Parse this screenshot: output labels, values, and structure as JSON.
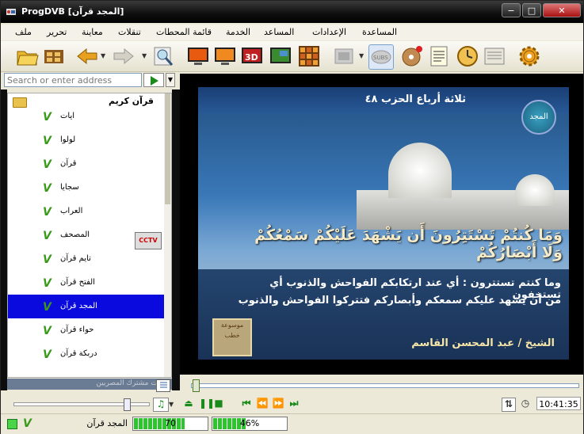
{
  "window": {
    "title": "ProgDVB [المجد قرآن]"
  },
  "window_buttons": {
    "minimize": "−",
    "restore": "□",
    "close": "✕"
  },
  "menu": [
    {
      "label": "المساعدة"
    },
    {
      "label": "الإعدادات"
    },
    {
      "label": "المساعد"
    },
    {
      "label": "الخدمة"
    },
    {
      "label": "قائمة المحطات"
    },
    {
      "label": "تنقلات"
    },
    {
      "label": "معاينة"
    },
    {
      "label": "تحرير"
    },
    {
      "label": "ملف"
    }
  ],
  "toolbar": {
    "icons": [
      "open-folder-icon",
      "film-strip-icon",
      "back-arrow-icon",
      "forward-arrow-icon",
      "magnifier-icon",
      "monitor-icon",
      "monitor-2-icon",
      "3d-icon",
      "picture-icon",
      "mosaic-icon",
      "channel-list-icon",
      "subtitles-icon",
      "record-disc-icon",
      "document-icon",
      "clock-icon",
      "teletext-icon",
      "gear-icon"
    ]
  },
  "address": {
    "placeholder": "Search or enter address"
  },
  "tree": {
    "root_label": "قرآن كريم",
    "items": [
      {
        "label": "ايات",
        "selected": false
      },
      {
        "label": "لولوا",
        "selected": false
      },
      {
        "label": "قرآن",
        "selected": false
      },
      {
        "label": "سجايا",
        "selected": false
      },
      {
        "label": "العراب",
        "selected": false
      },
      {
        "label": "المصحف",
        "selected": false
      },
      {
        "label": "تايم قرآن",
        "selected": false
      },
      {
        "label": "الفتح قرآن",
        "selected": false
      },
      {
        "label": "المجد قرآن",
        "selected": true
      },
      {
        "label": "حواء قرآن",
        "selected": false
      },
      {
        "label": "دربكة قرآن",
        "selected": false
      }
    ],
    "footer": "قنوات مشترك المصريين"
  },
  "badge": {
    "cctv": "CCTV"
  },
  "video": {
    "top_line": "ثلاثة أرباع الحزب ٤٨",
    "logo_text": "المجد",
    "verse": "وَمَا كُنتُمْ تَسْتَتِرُونَ أَن يَشْهَدَ عَلَيْكُمْ سَمْعُكُمْ وَلَا أَبْصَارُكُمْ",
    "translation_line1": "وما كنتم تستترون : أي عند ارتكابكم الفواحش والذنوب أي تستخفون",
    "translation_line2": "من أن يشهد عليكم سمعكم وأبصاركم فتتركوا الفواحش والذنوب",
    "credit": "الشيخ / عبد المحسن القاسم",
    "stamp_text": "موسوعة خطب"
  },
  "playback": {
    "seek_position": 0.01,
    "volume_level": 0.8,
    "time": "10:41:35"
  },
  "status": {
    "channel": "المجد قرآن",
    "signal_level_label": "70",
    "signal_level": 0.7,
    "quality_label": "46%",
    "quality_level": 0.46
  }
}
